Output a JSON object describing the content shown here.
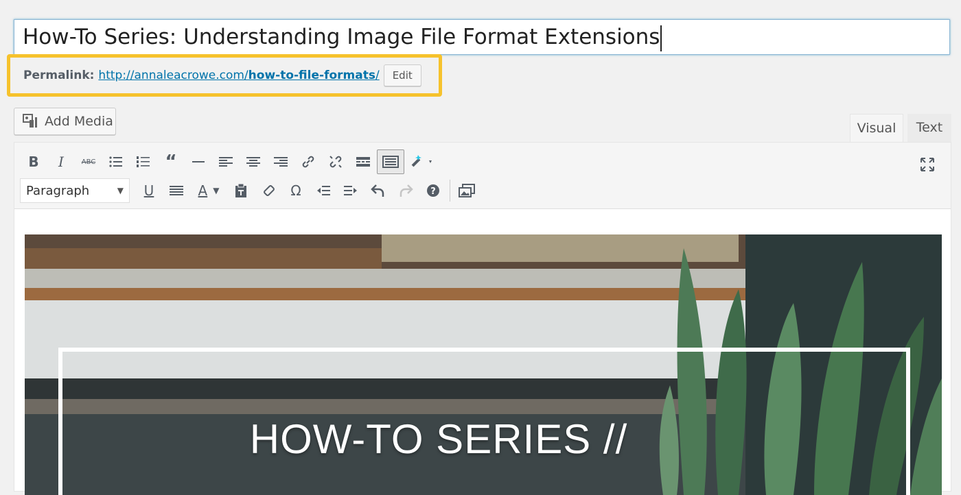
{
  "post": {
    "title": "How-To Series: Understanding Image File Format Extensions",
    "permalink_label": "Permalink:",
    "permalink_base": "http://annaleacrowe.com/",
    "permalink_slug": "how-to-file-formats",
    "permalink_trail": "/",
    "edit_label": "Edit"
  },
  "media": {
    "add_media_label": "Add Media"
  },
  "tabs": {
    "visual": "Visual",
    "text": "Text",
    "active": "visual"
  },
  "toolbar": {
    "row1": [
      "bold-icon",
      "italic-icon",
      "strikethrough-icon",
      "bulleted-list-icon",
      "numbered-list-icon",
      "blockquote-icon",
      "horizontal-rule-icon",
      "align-left-icon",
      "align-center-icon",
      "align-right-icon",
      "insert-link-icon",
      "remove-link-icon",
      "read-more-icon",
      "toolbar-toggle-icon",
      "magic-wand-icon"
    ],
    "row2": [
      "underline-icon",
      "justify-icon",
      "text-color-icon",
      "paste-as-text-icon",
      "clear-formatting-icon",
      "special-character-icon",
      "outdent-icon",
      "indent-icon",
      "undo-icon",
      "redo-icon",
      "help-icon",
      "insert-gallery-icon"
    ],
    "format_select_value": "Paragraph"
  },
  "content": {
    "hero_text": "HOW-TO SERIES  //"
  },
  "colors": {
    "highlight": "#f6c22c",
    "link": "#0073aa",
    "frame_border": "#8cb6d5"
  }
}
